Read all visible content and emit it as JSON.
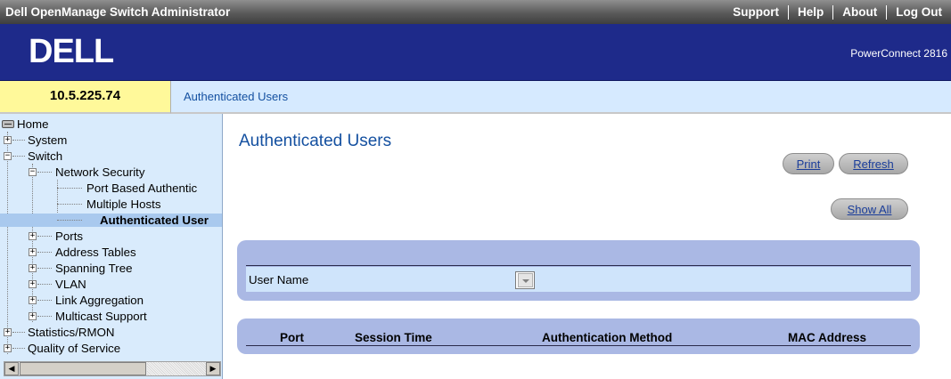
{
  "topbar": {
    "app_title": "Dell OpenManage Switch Administrator",
    "links": [
      "Support",
      "Help",
      "About",
      "Log Out"
    ]
  },
  "header": {
    "logo": "DELL",
    "model": "PowerConnect 2816"
  },
  "device_ip": "10.5.225.74",
  "breadcrumb": "Authenticated Users",
  "tree": {
    "home": "Home",
    "system": "System",
    "switch": "Switch",
    "network_security": "Network Security",
    "port_based_auth": "Port Based Authentic",
    "multiple_hosts": "Multiple Hosts",
    "authenticated_users": "Authenticated User",
    "ports": "Ports",
    "address_tables": "Address Tables",
    "spanning_tree": "Spanning Tree",
    "vlan": "VLAN",
    "link_aggregation": "Link Aggregation",
    "multicast_support": "Multicast Support",
    "statistics_rmon": "Statistics/RMON",
    "quality_of_service": "Quality of Service"
  },
  "main": {
    "title": "Authenticated Users",
    "print_label": "Print",
    "refresh_label": "Refresh",
    "show_all_label": "Show All",
    "filter": {
      "user_name_label": "User Name",
      "user_name_value": ""
    },
    "table": {
      "columns": [
        "Port",
        "Session Time",
        "Authentication Method",
        "MAC Address"
      ],
      "rows": []
    }
  },
  "colors": {
    "header_bg": "#1e2a8a",
    "sidebar_bg": "#d9ebfc",
    "panel_bg": "#aab8e4",
    "ip_bg": "#fff99a",
    "link": "#1450a0"
  }
}
